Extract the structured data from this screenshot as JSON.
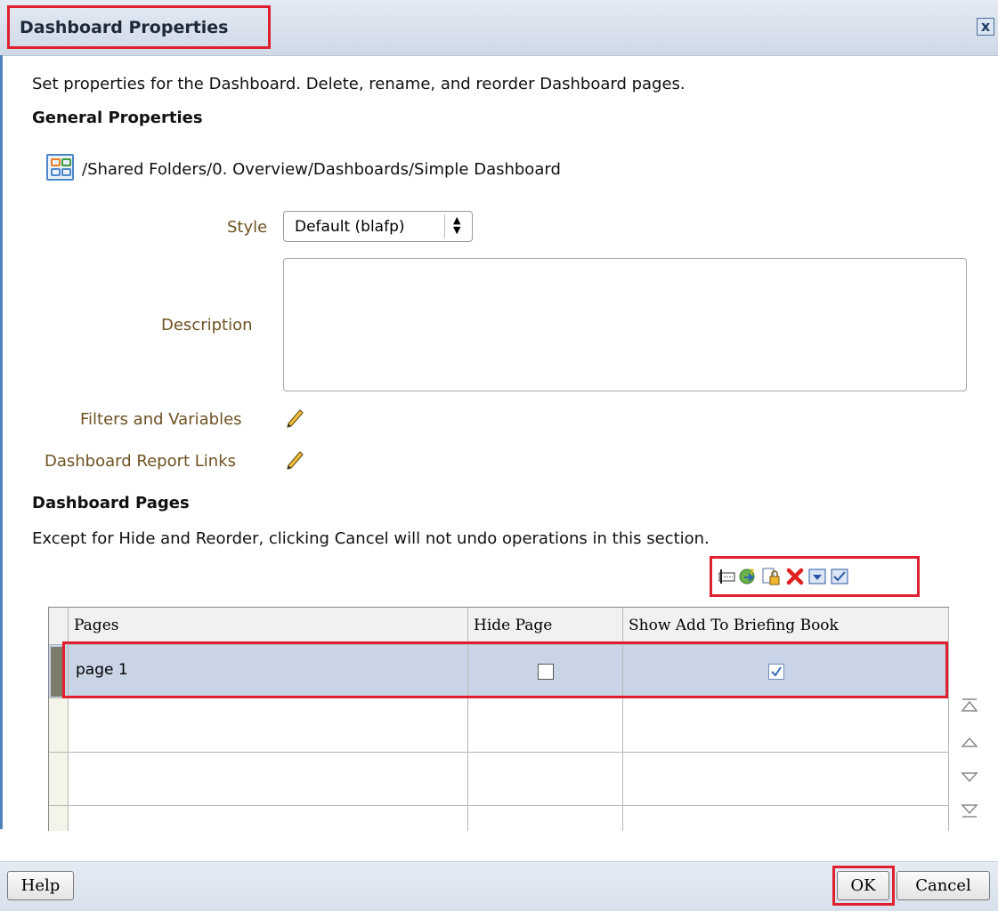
{
  "dialog": {
    "title": "Dashboard Properties",
    "close_label": "x",
    "intro": "Set properties for the Dashboard. Delete, rename, and reorder Dashboard pages."
  },
  "general": {
    "heading": "General Properties",
    "path": "/Shared Folders/0. Overview/Dashboards/Simple Dashboard",
    "style_label": "Style",
    "style_value": "Default (blafp)",
    "description_label": "Description",
    "description_value": "",
    "filters_label": "Filters and Variables",
    "report_links_label": "Dashboard Report Links"
  },
  "pages_section": {
    "heading": "Dashboard Pages",
    "note": "Except for Hide and Reorder, clicking Cancel will not undo operations in this section.",
    "toolbar": [
      "rename-page",
      "page-permissions",
      "page-security",
      "delete-page",
      "page-options",
      "show-add-to-briefing"
    ],
    "columns": [
      "Pages",
      "Hide Page",
      "Show Add To Briefing Book"
    ],
    "rows": [
      {
        "page": "page 1",
        "hide_page": false,
        "show_briefing": true
      }
    ]
  },
  "footer": {
    "help_label": "Help",
    "ok_label": "OK",
    "cancel_label": "Cancel"
  },
  "colors": {
    "accent": "#4f82bd",
    "highlight": "#e0202f",
    "label_text": "#6e5122",
    "selected_row": "#c9d4e6"
  }
}
